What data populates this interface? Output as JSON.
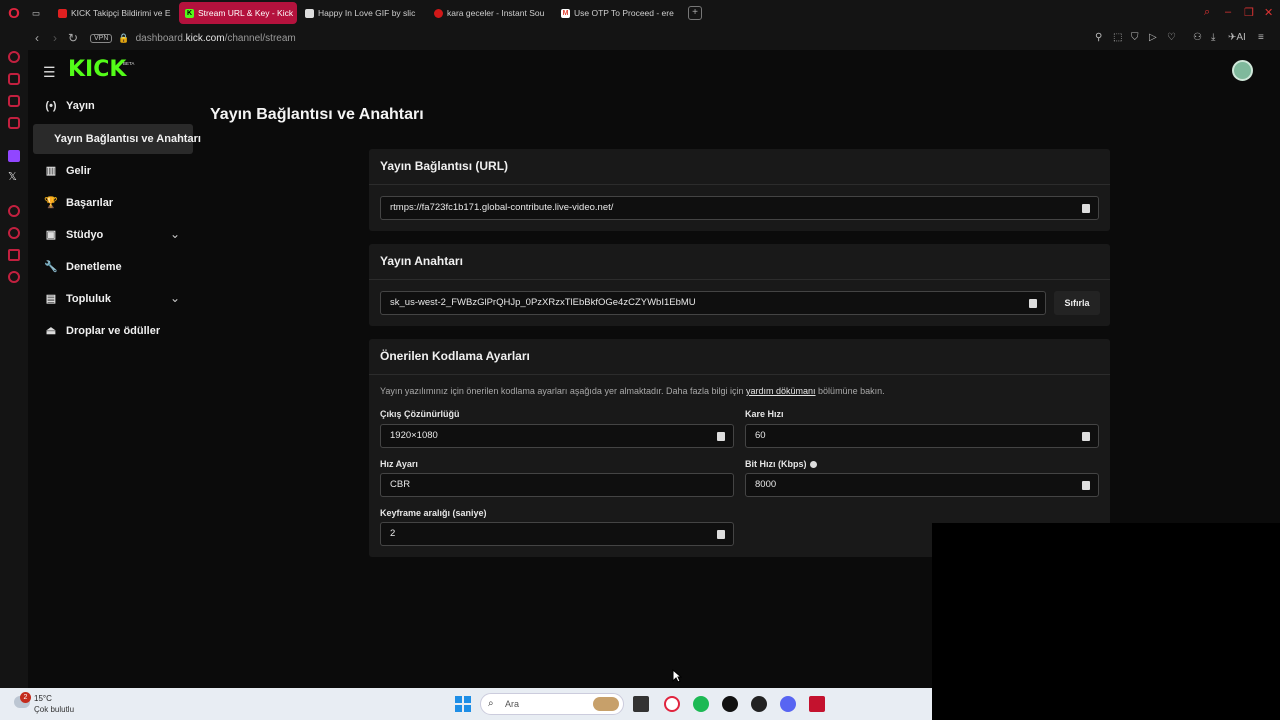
{
  "browser": {
    "tabs": [
      {
        "title": "KICK Takipçi Bildirimi ve E",
        "color": "#e02020",
        "active": false
      },
      {
        "title": "Stream URL & Key - Kick",
        "color": "#53fc18",
        "active": true,
        "fav": "K"
      },
      {
        "title": "Happy In Love GIF by slic",
        "color": "#dddddd",
        "active": false
      },
      {
        "title": "kara geceler - Instant Sou",
        "color": "#d01818",
        "active": false
      },
      {
        "title": "Use OTP To Proceed - ere",
        "color": "#e04436",
        "active": false,
        "fav": "M"
      }
    ],
    "url_prefix": "dashboard.",
    "url_domain": "kick.com",
    "url_path": "/channel/stream",
    "vpn_label": "VPN",
    "ai_label": "AI"
  },
  "sidebar": {
    "logo": "KICK",
    "beta": "BETA",
    "items": [
      {
        "label": "Yayın",
        "icon": "broadcast-icon",
        "glyph": "(•)"
      },
      {
        "label": "Gelir",
        "icon": "chart-icon",
        "glyph": "▥"
      },
      {
        "label": "Başarılar",
        "icon": "trophy-icon",
        "glyph": "🏆"
      },
      {
        "label": "Stüdyo",
        "icon": "studio-icon",
        "glyph": "▣"
      },
      {
        "label": "Denetleme",
        "icon": "wrench-icon",
        "glyph": "🔧"
      },
      {
        "label": "Topluluk",
        "icon": "community-icon",
        "glyph": "▤"
      },
      {
        "label": "Droplar ve ödüller",
        "icon": "drops-icon",
        "glyph": "⏏"
      }
    ],
    "active_sub": "Yayın Bağlantısı ve Anahtarı"
  },
  "page": {
    "title": "Yayın Bağlantısı ve Anahtarı"
  },
  "url_card": {
    "heading": "Yayın Bağlantısı (URL)",
    "value": "rtmps://fa723fc1b171.global-contribute.live-video.net/"
  },
  "key_card": {
    "heading": "Yayın Anahtarı",
    "value": "sk_us-west-2_FWBzGlPrQHJp_0PzXRzxTlEbBkfOGe4zCZYWbI1EbMU",
    "reset_label": "Sıfırla"
  },
  "encoding_card": {
    "heading": "Önerilen Kodlama Ayarları",
    "hint_before": "Yayın yazılımınız için önerilen kodlama ayarları aşağıda yer almaktadır. Daha fazla bilgi için ",
    "hint_link": "yardım dökümanı",
    "hint_after": " bölümüne bakın.",
    "resolution_label": "Çıkış Çözünürlüğü",
    "resolution_value": "1920×1080",
    "framerate_label": "Kare Hızı",
    "framerate_value": "60",
    "rate_label": "Hız Ayarı",
    "rate_value": "CBR",
    "bitrate_label": "Bit Hızı (Kbps)",
    "bitrate_value": "8000",
    "keyframe_label": "Keyframe aralığı (saniye)",
    "keyframe_value": "2"
  },
  "taskbar": {
    "weather_badge": "2",
    "temp": "15°C",
    "condition": "Çok bulutlu",
    "search_placeholder": "Ara"
  }
}
